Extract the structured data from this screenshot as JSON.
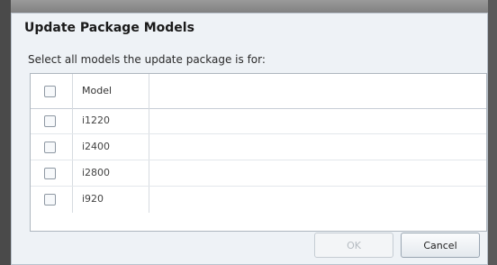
{
  "dialog": {
    "title": "Update Package Models",
    "instruction": "Select all models the update package is for:"
  },
  "grid": {
    "header": {
      "model_label": "Model",
      "select_all_checked": false
    },
    "rows": [
      {
        "model": "i1220",
        "checked": false
      },
      {
        "model": "i2400",
        "checked": false
      },
      {
        "model": "i2800",
        "checked": false
      },
      {
        "model": "i920",
        "checked": false
      }
    ]
  },
  "buttons": {
    "ok_label": "OK",
    "ok_enabled": false,
    "cancel_label": "Cancel"
  }
}
